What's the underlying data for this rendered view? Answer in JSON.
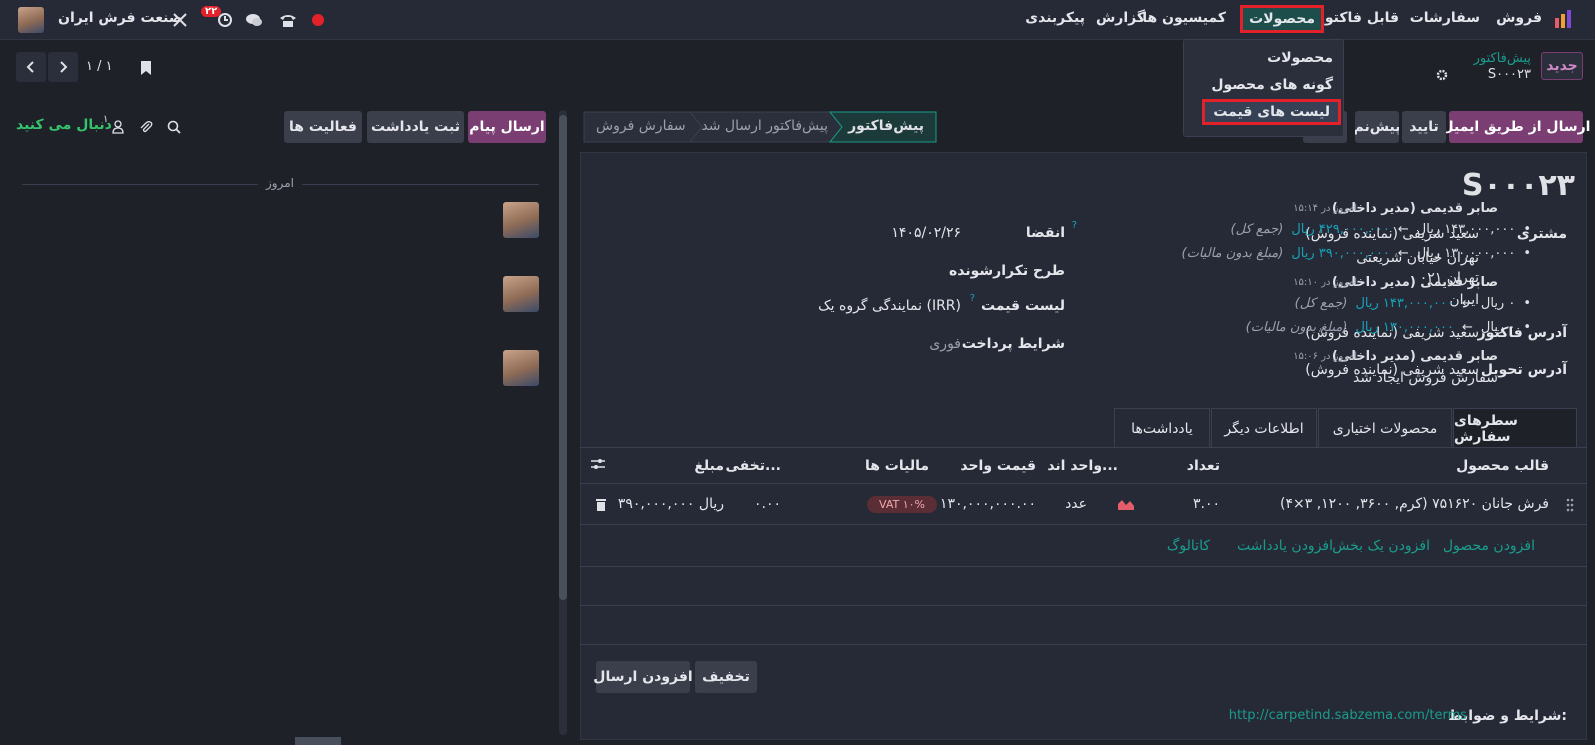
{
  "topbar": {
    "menu": [
      "فروش",
      "سفارشات",
      "قابل فاکتور",
      "محصولات",
      "کمیسیون ها",
      "گزارش",
      "پیکربندی"
    ],
    "company": "صنعت فرش ایران",
    "badge": "۲۲"
  },
  "dropdown": {
    "items": [
      "محصولات",
      "گونه های محصول",
      "لیست های قیمت"
    ]
  },
  "controlbar": {
    "new": "جدید",
    "breadcrumb_parent": "پیش‌فاکتور",
    "record": "S۰۰۰۲۳",
    "pager": "۱ / ۱"
  },
  "actions": {
    "send_email": "ارسال از طریق ایمیل",
    "confirm": "تایید",
    "preview": "پیش‌نم"
  },
  "stages": [
    "پیش‌فاکتور",
    "پیش‌فاکتور ارسال شد",
    "سفارش فروش"
  ],
  "form": {
    "title": "S۰۰۰۲۳",
    "customer_label": "مشتری",
    "customer_lines": [
      "سعید شریفی (نماینده فروش)",
      "تهران خیابان شریعتی",
      "تهران ۰۲۱",
      "ایران"
    ],
    "invoice_addr_label": "آدرس فاکتور",
    "invoice_addr": "سعید شریفی (نماینده فروش)",
    "delivery_addr_label": "آدرس تحویل",
    "delivery_addr": "سعید شریفی (نماینده فروش)",
    "expiry_label": "انقضا",
    "expiry": "۱۴۰۵/۰۲/۲۶",
    "recurring_label": "طرح تکرارشونده",
    "pricelist_label": "لیست قیمت",
    "pricelist": "نمایندگی گروه یک (IRR)",
    "payment_label": "شرایط پرداخت",
    "payment": "فوری",
    "help_mark": "?"
  },
  "tabs": [
    "سطرهای سفارش",
    "محصولات اختیاری",
    "اطلاعات دیگر",
    "یادداشت‌ها"
  ],
  "table": {
    "headers": [
      "قالب محصول",
      "تعداد",
      "واحد اند...",
      "قیمت واحد",
      "مالیات ها",
      "تخفی...",
      "مبلغ"
    ],
    "row": {
      "product": "فرش جانان ۷۵۱۶۲۰ (کرم, ۳۶۰۰, ۱۲۰۰, ۳×۴)",
      "qty": "۳.۰۰",
      "uom": "عدد",
      "unit_price": "۱۳۰,۰۰۰,۰۰۰.۰۰",
      "tax": "VAT ۱۰%",
      "discount": "۰.۰۰",
      "amount": "۳۹۰,۰۰۰,۰۰۰ ریال"
    },
    "add_links": [
      "افزودن محصول",
      "افزودن یک بخش",
      "افزودن یادداشت",
      "کاتالوگ"
    ]
  },
  "footer_buttons": {
    "discount": "تخفیف",
    "shipping": "افزودن ارسال"
  },
  "terms": {
    "label": "شرایط و ضوابط:",
    "url": "http://carpetind.sabzema.com/terms"
  },
  "chatter": {
    "send_message": "ارسال پیام",
    "log_note": "ثبت یادداشت",
    "activities": "فعالیت ها",
    "follow": "دنبال می کنید",
    "followers": "۱",
    "today": "امروز",
    "messages": [
      {
        "author": "صابر قدیمی (مدیر داخلی)",
        "time": "امروز در ۱۵:۱۴",
        "lines": [
          {
            "old": "۱۴۳,۰۰۰,۰۰۰ ریال",
            "new": "۴۲۹,۰۰۰,۰۰۰ ریال",
            "field": "(جمع کل)"
          },
          {
            "old": "۱۳۰,۰۰۰,۰۰۰ ریال",
            "new": "۳۹۰,۰۰۰,۰۰۰ ریال",
            "field": "(مبلغ بدون مالیات)"
          }
        ]
      },
      {
        "author": "صابر قدیمی (مدیر داخلی)",
        "time": "امروز در ۱۵:۱۰",
        "lines": [
          {
            "old": "۰ ریال",
            "new": "۱۴۳,۰۰۰,۰۰۰ ریال",
            "field": "(جمع کل)"
          },
          {
            "old": "۰ ریال",
            "new": "۱۳۰,۰۰۰,۰۰۰ ریال",
            "field": "(مبلغ بدون مالیات)"
          }
        ]
      },
      {
        "author": "صابر قدیمی (مدیر داخلی)",
        "time": "امروز در ۱۵:۰۶",
        "body": "سفارش فروش ایجاد شد"
      }
    ]
  },
  "colors": {
    "accent": "#1a9c8c",
    "primary": "#7a3e72",
    "highlight": "#e3212b"
  }
}
